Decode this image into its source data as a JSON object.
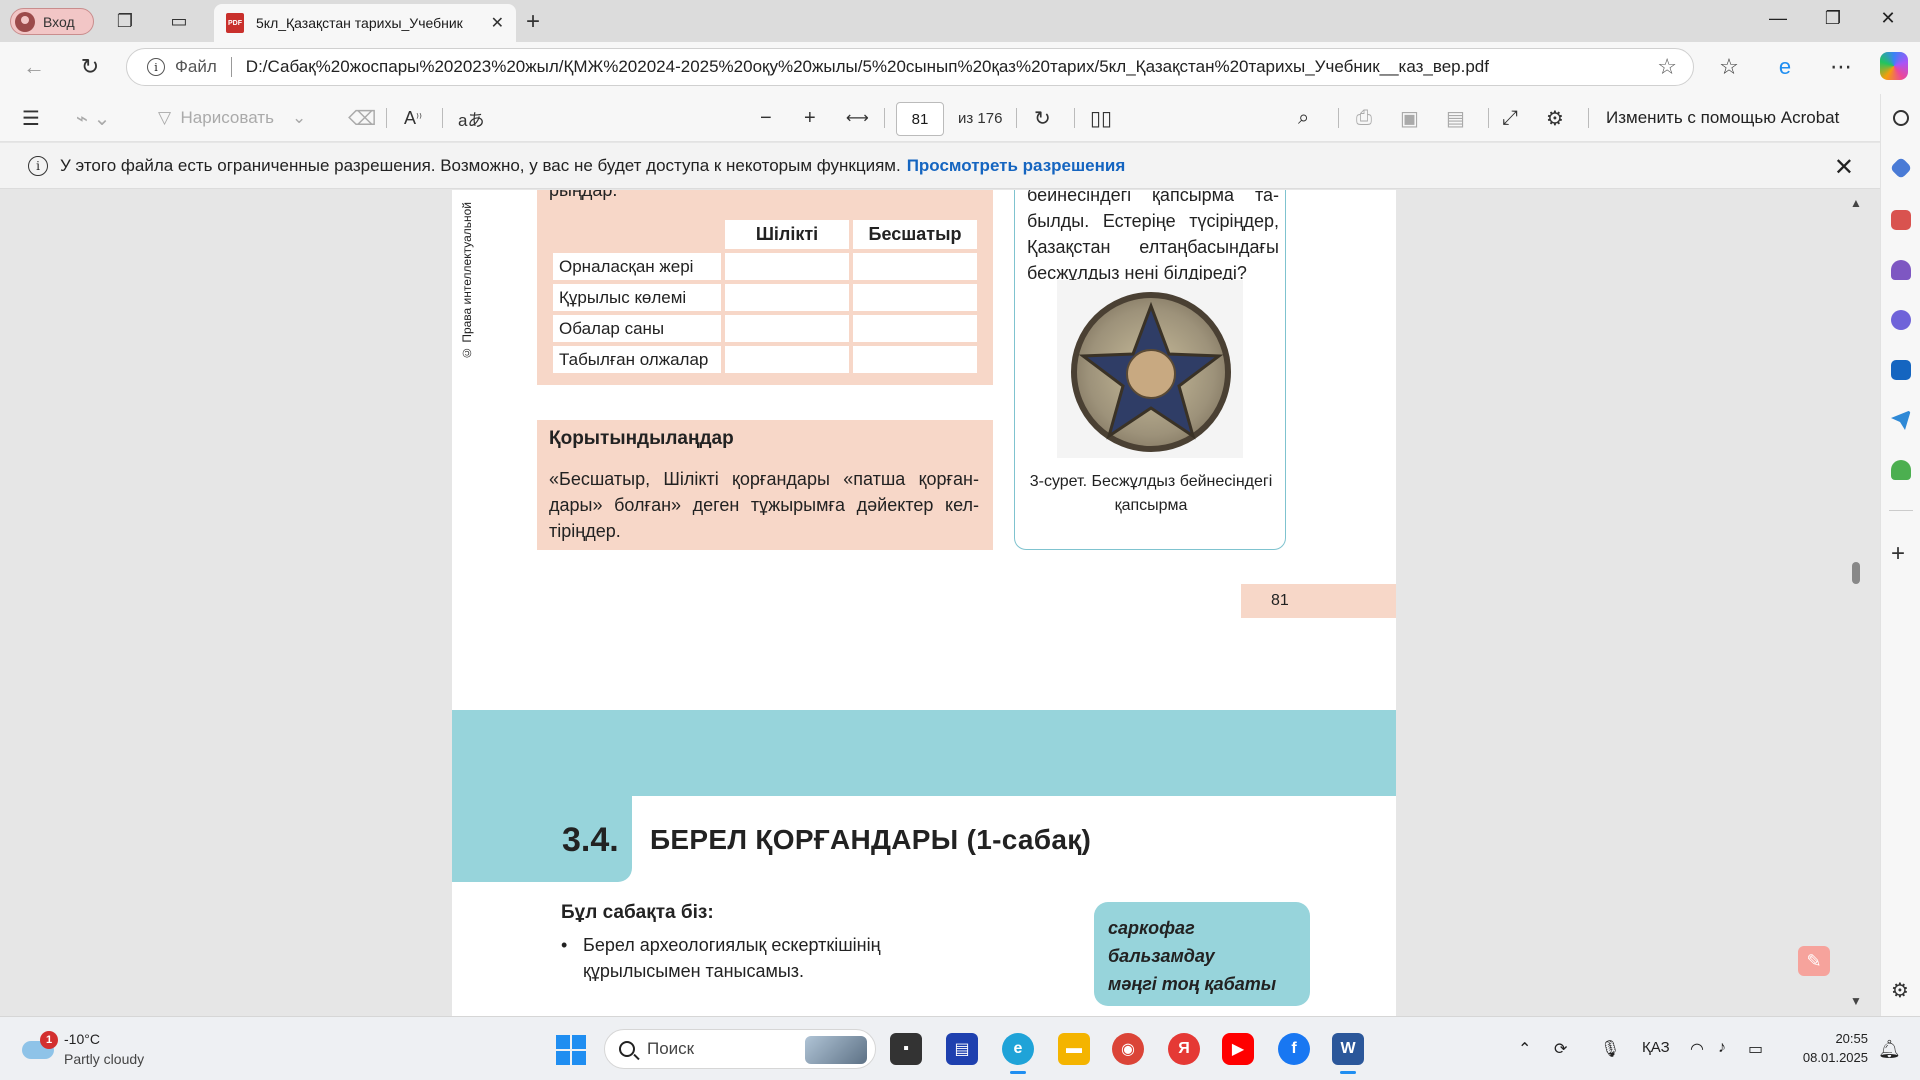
{
  "browser": {
    "profile_label": "Вход",
    "tab_title": "5кл_Қазақстан тарихы_Учебник",
    "tab_badge": "PDF",
    "address": {
      "file_label": "Файл",
      "url": "D:/Сабақ%20жоспары%202023%20жыл/ҚМЖ%202024-2025%20оқу%20жылы/5%20сынып%20қаз%20тарих/5кл_Қазақстан%20тарихы_Учебник__каз_вер.pdf"
    }
  },
  "pdf_toolbar": {
    "draw_label": "Нарисовать",
    "read_aloud_label": "A",
    "translate_label": "aあ",
    "current_page": "81",
    "page_total": "из 176",
    "acrobat_label": "Изменить с помощью Acrobat"
  },
  "info_bar": {
    "message": "У этого файла есть ограниченные разрешения. Возможно, у вас не будет доступа к некоторым функциям.",
    "link": "Просмотреть разрешения"
  },
  "page81": {
    "copyright": "© Права интеллектуальной",
    "task_tail": "рыңдар.",
    "table": {
      "columns": [
        "Шілікті",
        "Бесшатыр"
      ],
      "rows": [
        "Орналасқан жері",
        "Құрылыс көлемі",
        "Обалар саны",
        "Табылған олжалар"
      ]
    },
    "conclusion": {
      "heading": "Қорытындылаңдар",
      "text": "«Бесшатыр, Шілікті қорғандары «патша қорған-дары» болған» деген тұжырымға дәйектер кел-тіріңдер."
    },
    "sidebar": {
      "question": "бейнесіндегі қапсырма та-былды. Естеріңе түсіріңдер, Қазақстан елтаңбасындағы бесжұлдыз нені білдіреді?",
      "caption": "3-сурет. Бесжұлдыз бейнесіндегі қапсырма"
    },
    "page_number": "81"
  },
  "page82": {
    "lesson_number": "3.4.",
    "lesson_title": "БЕРЕЛ ҚОРҒАНДАРЫ (1-сабақ)",
    "we_will_heading": "Бұл сабақта біз:",
    "bullet_1": "Берел археологиялық ескерткішінің құрылысымен танысамыз.",
    "keywords": [
      "саркофаг",
      "бальзамдау",
      "мәңгі тоң қабаты"
    ]
  },
  "taskbar": {
    "weather_badge": "1",
    "weather_temp": "-10°C",
    "weather_desc": "Partly cloudy",
    "search_placeholder": "Поиск",
    "language": "ҚАЗ",
    "time": "20:55",
    "date": "08.01.2025"
  },
  "colors": {
    "peach": "#f7d7c8",
    "teal": "#97d4db",
    "link": "#1565c0"
  }
}
